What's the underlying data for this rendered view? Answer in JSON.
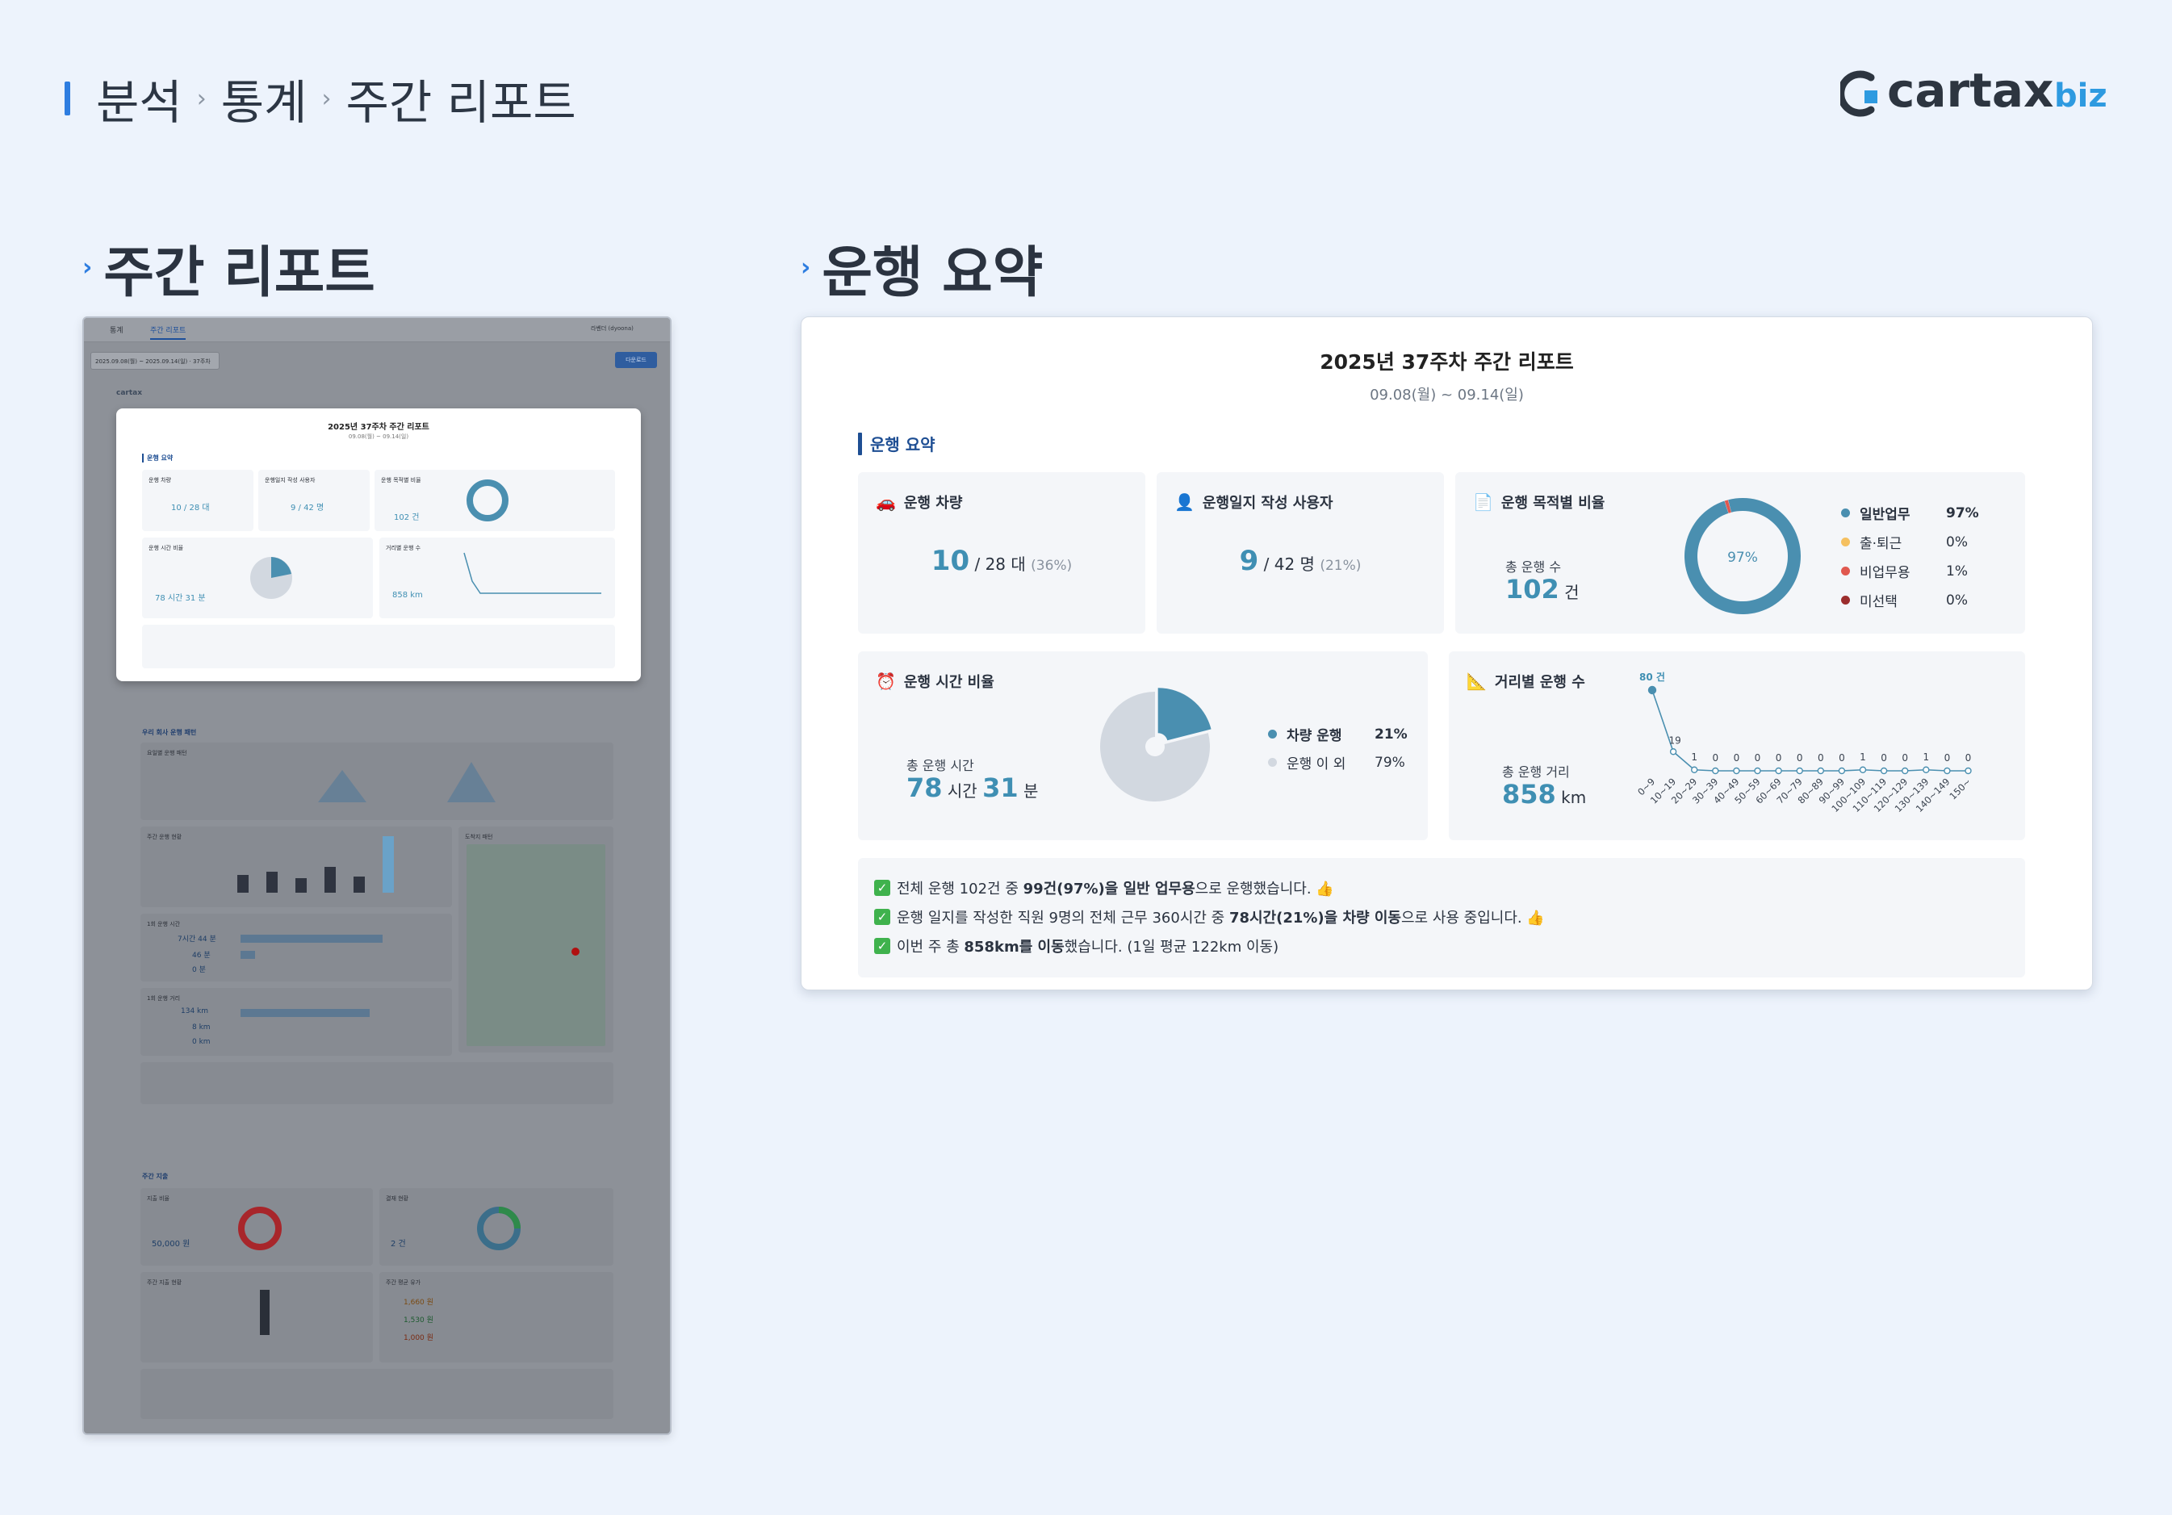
{
  "breadcrumb": {
    "items": [
      "분석",
      "통계",
      "주간 리포트"
    ]
  },
  "logo": {
    "text": "cartax",
    "suffix": "biz"
  },
  "left_section": {
    "title": "주간 리포트"
  },
  "right_section": {
    "title": "운행 요약"
  },
  "thumbnail": {
    "tabs": [
      "통계",
      "주간 리포트"
    ],
    "user": "라벤더 (dyoona)",
    "date_range": "2025.09.08(월) ~ 2025.09.14(일) · 37주차",
    "export_button": "다운로드",
    "report_title": "2025년 37주차 주간 리포트",
    "report_sub": "09.08(월) ~ 09.14(일)",
    "labels": {
      "sum_h": "운행 요약",
      "vehicle": "운행 차량",
      "users": "운행일지 작성 사용자",
      "purpose": "운행 목적별 비율",
      "time": "운행 시간 비율",
      "distance": "거리별 운행 수",
      "company_h": "우리 회사 운행 패턴",
      "daily_h": "요일별 운행 패턴",
      "weekly_h": "주간 운행 현황",
      "arrival_h": "도착지 패턴",
      "time1_h": "1회 운행 시간",
      "dist1_h": "1회 운행 거리",
      "cost_h": "주간 지출",
      "cost_ratio": "지출 비율",
      "cost_status": "결재 현황",
      "weekly_cost": "주간 지출 현황",
      "fuel_avg": "주간 평균 유가"
    },
    "values": {
      "vehicle": "10 / 28 대",
      "users": "9 / 42 명",
      "trips": "102 건",
      "hours": "78 시간 31 분",
      "km": "858 km",
      "t_max": "7시간 44 분",
      "t_avg": "46 분",
      "t_min": "0 분",
      "d_max": "134 km",
      "d_avg": "8 km",
      "d_min": "0 km",
      "cost": "50,000 원",
      "approvals": "2 건",
      "fuel1": "1,660 원",
      "fuel2": "1,530 원",
      "fuel3": "1,000 원"
    }
  },
  "card": {
    "title": "2025년 37주차 주간 리포트",
    "subtitle": "09.08(월) ~ 09.14(일)",
    "summary_heading": "운행 요약",
    "vehicle": {
      "label": "운행 차량",
      "value": "10",
      "text": "/ 28 대",
      "pct": "(36%)"
    },
    "users": {
      "label": "운행일지 작성 사용자",
      "value": "9",
      "text": "/ 42 명",
      "pct": "(21%)"
    },
    "purpose": {
      "label": "운행 목적별 비율",
      "total_label": "총 운행 수",
      "total_value": "102",
      "total_unit": "건",
      "center": "97%",
      "legend": [
        {
          "name": "일반업무",
          "pct": "97%",
          "value": 97,
          "color": "#4a8fb0"
        },
        {
          "name": "출·퇴근",
          "pct": "0%",
          "value": 0,
          "color": "#f5c060"
        },
        {
          "name": "비업무용",
          "pct": "1%",
          "value": 1,
          "color": "#e0584f"
        },
        {
          "name": "미선택",
          "pct": "0%",
          "value": 0,
          "color": "#9b2d2d"
        }
      ]
    },
    "time": {
      "label": "운행 시간 비율",
      "total_label": "총 운행 시간",
      "hours": "78",
      "hours_unit": "시간",
      "minutes": "31",
      "minutes_unit": "분",
      "legend": [
        {
          "name": "차량 운행",
          "pct": "21%",
          "value": 21,
          "color": "#4a8fb0"
        },
        {
          "name": "운행 이 외",
          "pct": "79%",
          "value": 79,
          "color": "#d2d8e0"
        }
      ]
    },
    "distance": {
      "label": "거리별 운행 수",
      "total_label": "총 운행 거리",
      "value": "858",
      "unit": "km"
    },
    "notes": [
      {
        "parts": [
          [
            "전체 운행 102건 중 ",
            false
          ],
          [
            "99건(97%)을 일반 업무용",
            true
          ],
          [
            "으로 운행했습니다. 👍",
            false
          ]
        ]
      },
      {
        "parts": [
          [
            "운행 일지를 작성한 직원 9명의 전체 근무 360시간 중 ",
            false
          ],
          [
            "78시간(21%)을 차량 이동",
            true
          ],
          [
            "으로 사용 중입니다. 👍",
            false
          ]
        ]
      },
      {
        "parts": [
          [
            "이번 주 총 ",
            false
          ],
          [
            "858km를 이동",
            true
          ],
          [
            "했습니다. (1일 평균 122km 이동)",
            false
          ]
        ]
      }
    ]
  },
  "chart_data": [
    {
      "type": "pie",
      "title": "운행 목적별 비율",
      "categories": [
        "일반업무",
        "출·퇴근",
        "비업무용",
        "미선택"
      ],
      "values": [
        97,
        0,
        1,
        0
      ]
    },
    {
      "type": "pie",
      "title": "운행 시간 비율",
      "categories": [
        "차량 운행",
        "운행 이 외"
      ],
      "values": [
        21,
        79
      ]
    },
    {
      "type": "line",
      "title": "거리별 운행 수",
      "categories": [
        "0~9",
        "10~19",
        "20~29",
        "30~39",
        "40~49",
        "50~59",
        "60~69",
        "70~79",
        "80~89",
        "90~99",
        "100~109",
        "110~119",
        "120~129",
        "130~139",
        "140~149",
        "150~"
      ],
      "values": [
        80,
        19,
        1,
        0,
        0,
        0,
        0,
        0,
        0,
        0,
        1,
        0,
        0,
        1,
        0,
        0
      ],
      "point_labels": [
        "80 건",
        "19",
        "1",
        "0",
        "0",
        "0",
        "0",
        "0",
        "0",
        "0",
        "1",
        "0",
        "0",
        "1",
        "0",
        "0"
      ],
      "ylim": [
        0,
        80
      ]
    }
  ]
}
